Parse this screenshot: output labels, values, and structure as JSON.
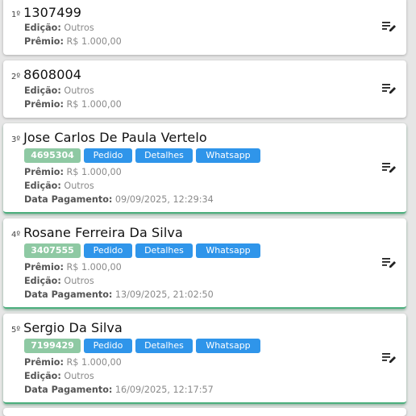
{
  "labels": {
    "edicao": "Edição:",
    "premio": "Prêmio:",
    "data_pagamento": "Data Pagamento:",
    "pedido": "Pedido",
    "detalhes": "Detalhes",
    "whatsapp": "Whatsapp"
  },
  "entries": [
    {
      "rank": "1º",
      "title": "1307499",
      "edicao": "Outros",
      "premio": "R$ 1.000,00"
    },
    {
      "rank": "2º",
      "title": "8608004",
      "edicao": "Outros",
      "premio": "R$ 1.000,00"
    },
    {
      "rank": "3º",
      "title": "Jose Carlos De Paula Vertelo",
      "code": "4695304",
      "premio": "R$ 1.000,00",
      "edicao": "Outros",
      "data_pagamento": "09/09/2025, 12:29:34"
    },
    {
      "rank": "4º",
      "title": "Rosane Ferreira Da Silva",
      "code": "3407555",
      "premio": "R$ 1.000,00",
      "edicao": "Outros",
      "data_pagamento": "13/09/2025, 21:02:50"
    },
    {
      "rank": "5º",
      "title": "Sergio Da Silva",
      "code": "7199429",
      "premio": "R$ 1.000,00",
      "edicao": "Outros",
      "data_pagamento": "16/09/2025, 12:17:57"
    }
  ],
  "colors": {
    "code_chip": "#8ec9a3",
    "action_button": "#2f95ea",
    "paid_border": "#4caf7d"
  },
  "icons": {
    "card_menu": "playlist-edit-icon"
  }
}
